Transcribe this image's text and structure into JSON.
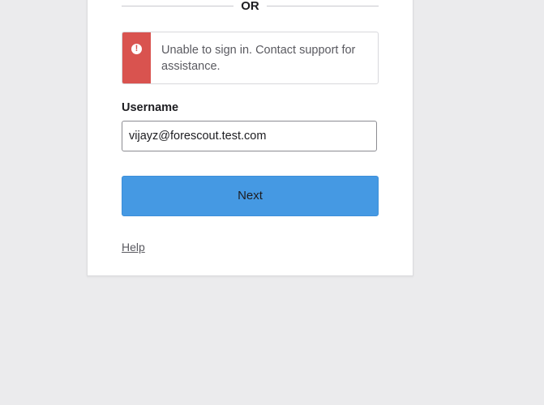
{
  "divider": {
    "label": "OR"
  },
  "error": {
    "icon": "exclamation-circle-icon",
    "icon_glyph": "!",
    "message": "Unable to sign in. Contact support for assistance.",
    "color": "#d9534f"
  },
  "username": {
    "label": "Username",
    "value": "vijayz@forescout.test.com"
  },
  "next_button": {
    "label": "Next",
    "color": "#4599e3"
  },
  "help": {
    "label": "Help"
  }
}
